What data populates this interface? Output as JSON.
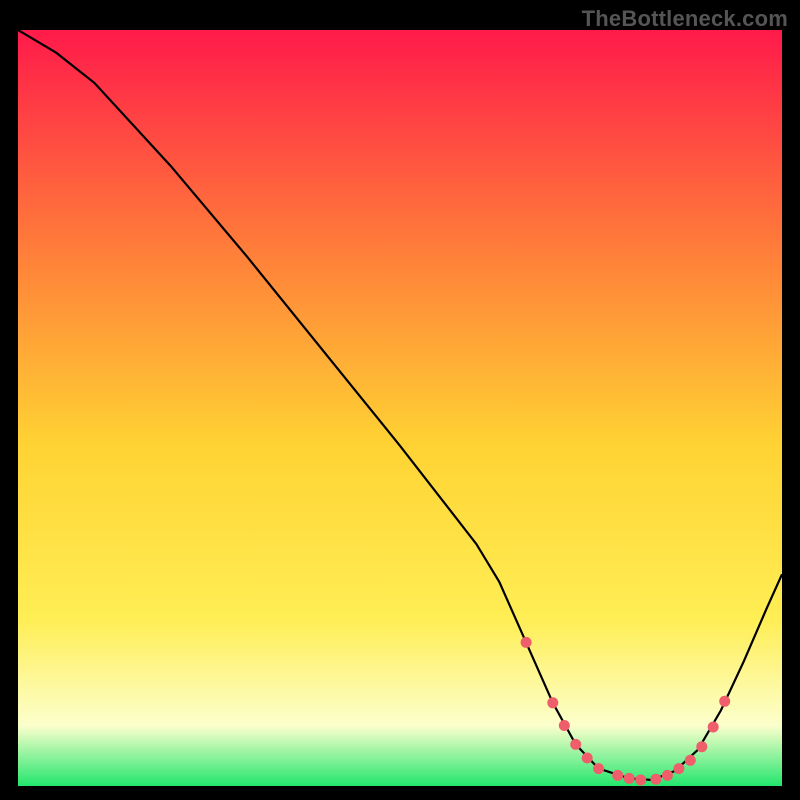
{
  "watermark": "TheBottleneck.com",
  "colors": {
    "frame": "#000000",
    "gradient_top": "#ff1a4a",
    "gradient_mid_upper": "#ff7a3a",
    "gradient_mid": "#ffd333",
    "gradient_mid_lower": "#ffee55",
    "gradient_pale": "#fcffcc",
    "gradient_green": "#23e66e",
    "curve": "#000000",
    "marker": "#ef5e6b"
  },
  "chart_data": {
    "type": "line",
    "title": "",
    "xlabel": "",
    "ylabel": "",
    "xlim": [
      0,
      100
    ],
    "ylim": [
      0,
      100
    ],
    "curves": [
      {
        "name": "bottleneck-curve",
        "x": [
          0,
          5,
          10,
          20,
          30,
          40,
          50,
          55,
          60,
          63,
          66.5,
          70,
          73,
          76,
          80,
          83,
          86,
          89,
          92,
          95,
          98,
          100
        ],
        "y": [
          100,
          97,
          93,
          82,
          70,
          57.5,
          45,
          38.5,
          32,
          27,
          19,
          11,
          5.5,
          2.3,
          1.0,
          0.8,
          2.0,
          4.8,
          10,
          16.5,
          23.5,
          28
        ]
      }
    ],
    "markers": {
      "name": "highlight-points",
      "x": [
        66.5,
        70.0,
        71.5,
        73.0,
        74.5,
        76.0,
        78.5,
        80.0,
        81.5,
        83.5,
        85.0,
        86.5,
        88.0,
        89.5,
        91.0,
        92.5
      ],
      "y": [
        19.0,
        11.0,
        8.0,
        5.5,
        3.7,
        2.3,
        1.4,
        1.0,
        0.8,
        0.9,
        1.4,
        2.3,
        3.4,
        5.2,
        7.8,
        11.2
      ]
    }
  }
}
